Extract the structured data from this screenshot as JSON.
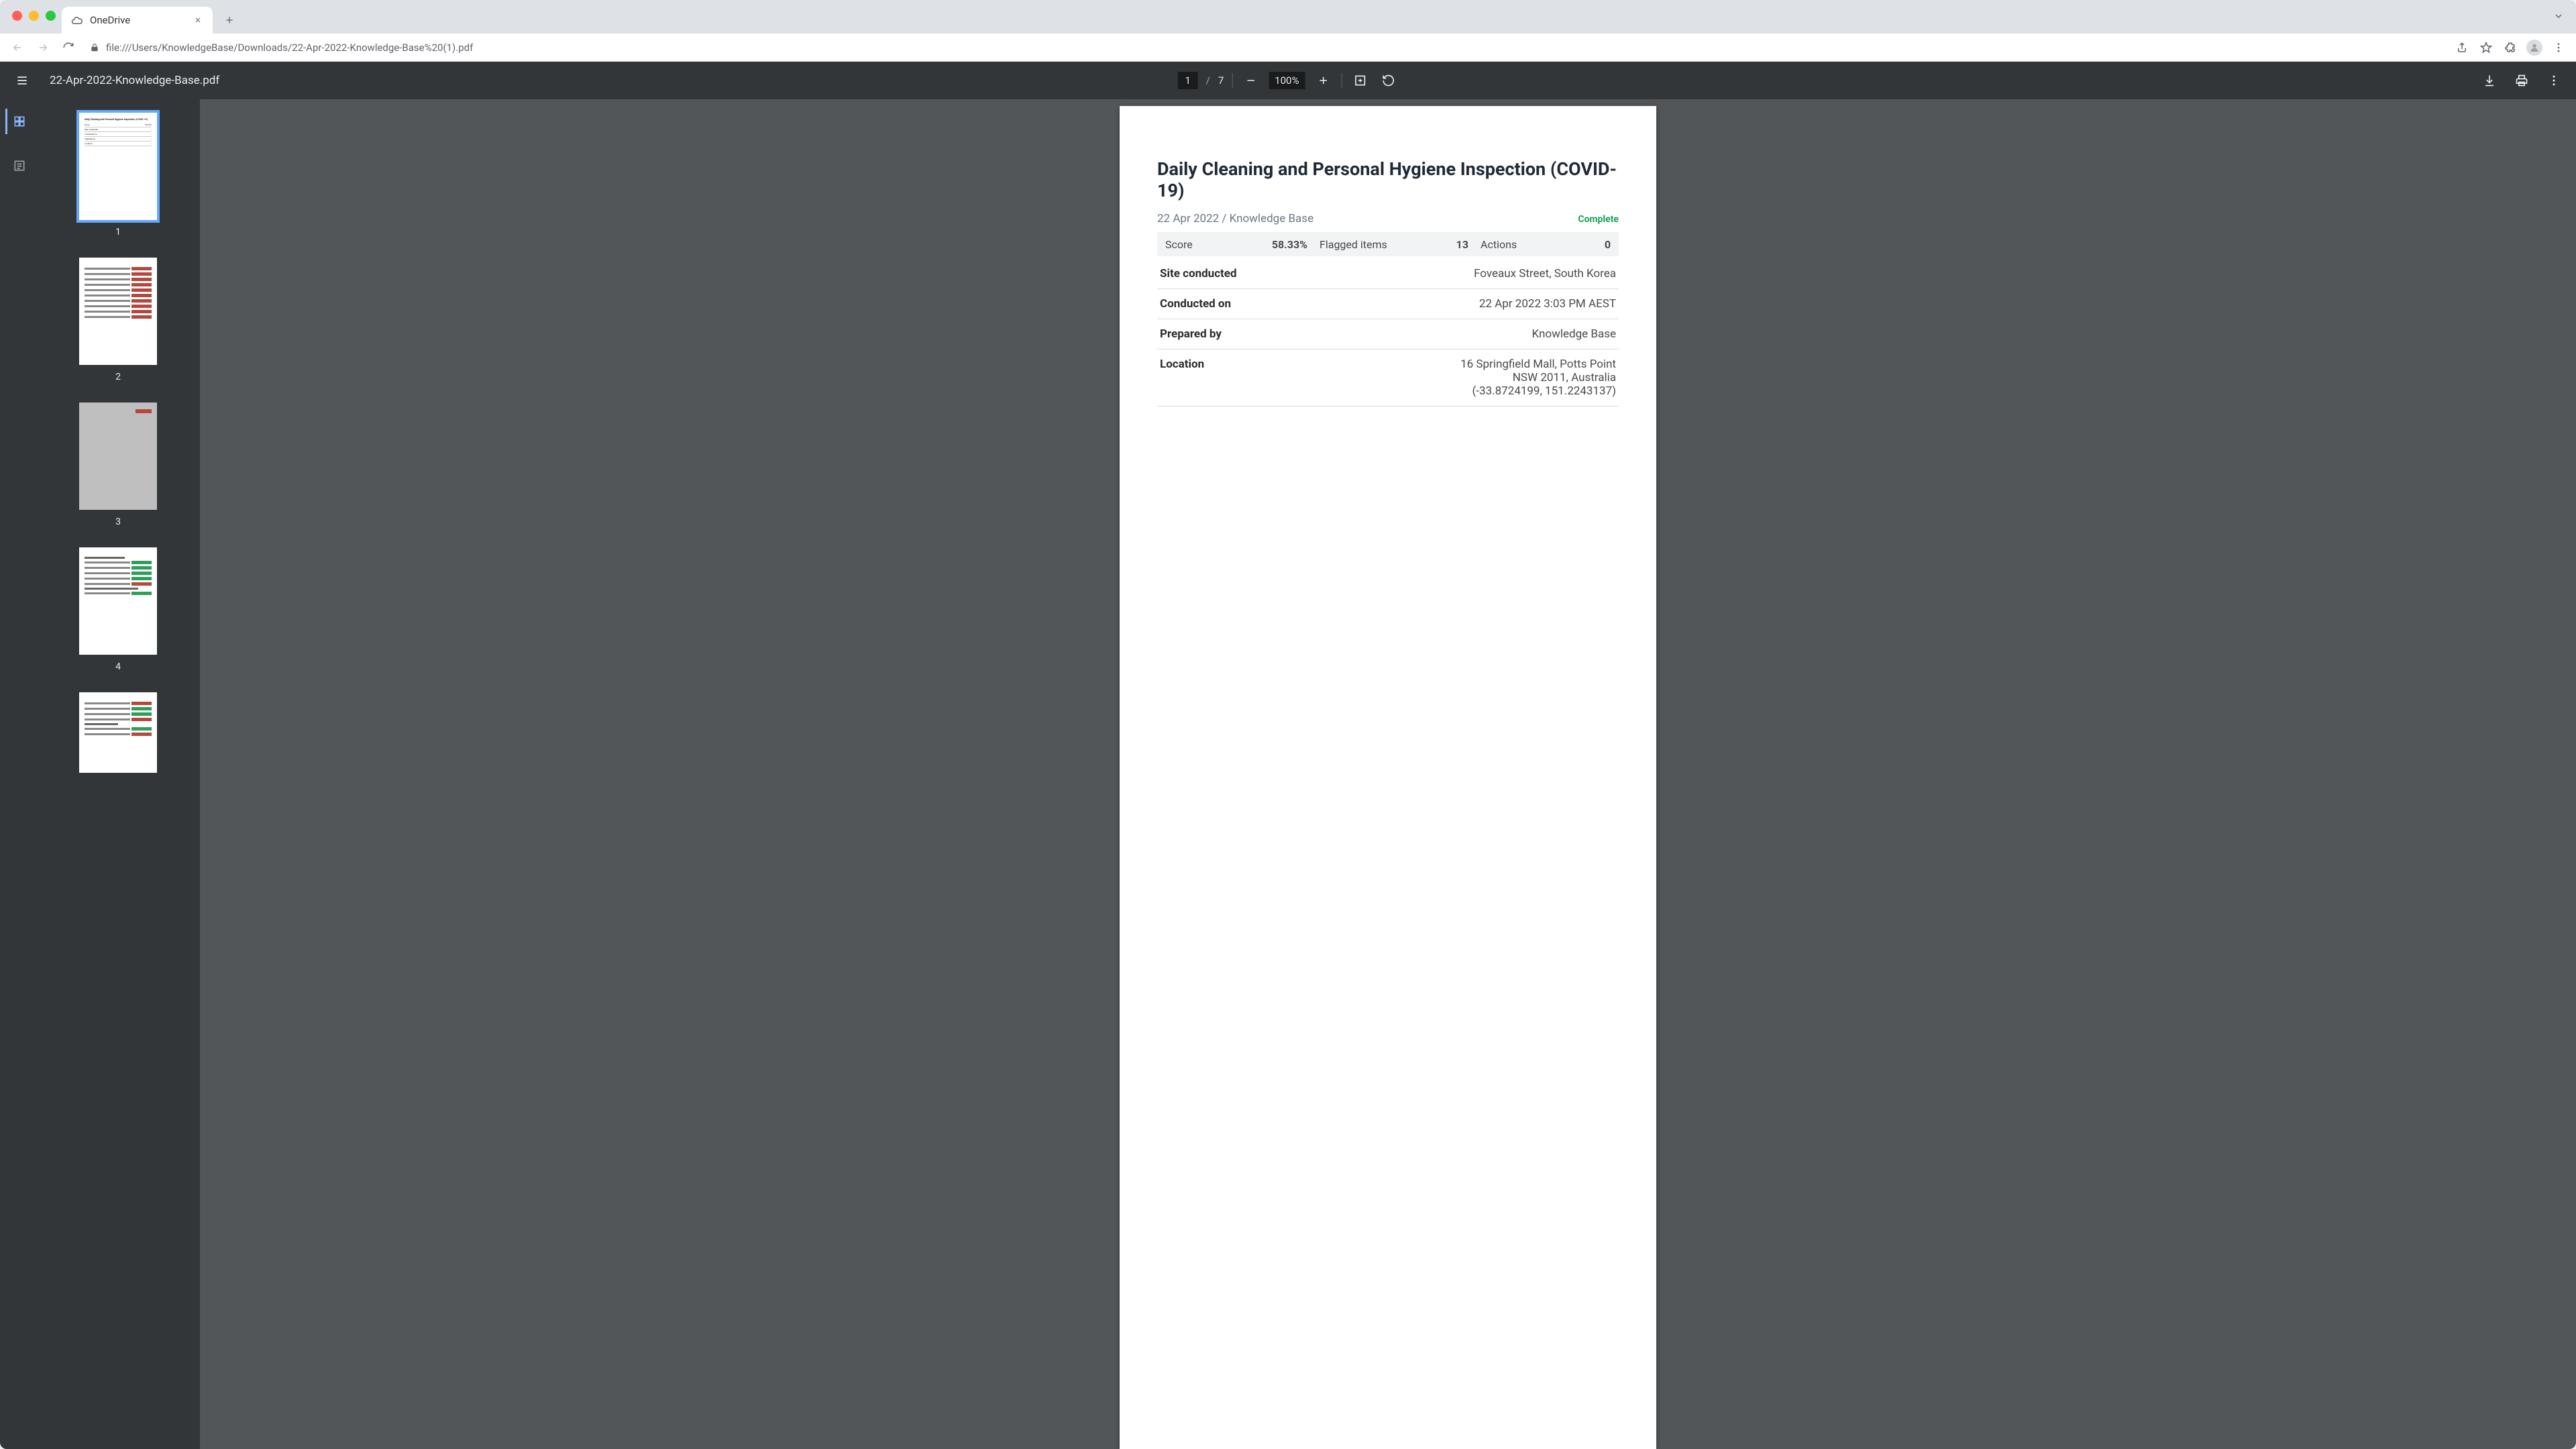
{
  "browser": {
    "tab_title": "OneDrive",
    "url": "file:///Users/KnowledgeBase/Downloads/22-Apr-2022-Knowledge-Base%20(1).pdf"
  },
  "pdf": {
    "filename": "22-Apr-2022-Knowledge-Base.pdf",
    "current_page": "1",
    "total_pages": "7",
    "zoom": "100%"
  },
  "thumbnails": [
    "1",
    "2",
    "3",
    "4"
  ],
  "doc": {
    "title": "Daily Cleaning and Personal Hygiene Inspection (COVID-19)",
    "date_author": "22 Apr 2022 / Knowledge Base",
    "status": "Complete",
    "stats": {
      "score_label": "Score",
      "score_value": "58.33%",
      "flagged_label": "Flagged items",
      "flagged_value": "13",
      "actions_label": "Actions",
      "actions_value": "0"
    },
    "rows": {
      "site_label": "Site conducted",
      "site_value": "Foveaux Street, South Korea",
      "conducted_label": "Conducted on",
      "conducted_value": "22 Apr 2022 3:03 PM AEST",
      "prepared_label": "Prepared by",
      "prepared_value": "Knowledge Base",
      "location_label": "Location",
      "location_line1": "16 Springfield Mall, Potts Point",
      "location_line2": "NSW 2011, Australia",
      "location_line3": "(-33.8724199, 151.2243137)"
    }
  }
}
